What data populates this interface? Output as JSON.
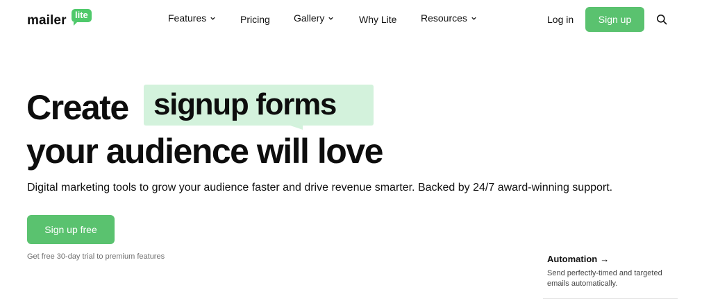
{
  "brand": {
    "name": "mailer",
    "badge": "lite",
    "accent": "#5ac26f",
    "highlight": "#d3f2dc"
  },
  "nav": {
    "items": [
      {
        "label": "Features",
        "dropdown": true
      },
      {
        "label": "Pricing",
        "dropdown": false
      },
      {
        "label": "Gallery",
        "dropdown": true
      },
      {
        "label": "Why Lite",
        "dropdown": false
      },
      {
        "label": "Resources",
        "dropdown": true
      }
    ],
    "login": "Log in",
    "signup": "Sign up",
    "search_icon": "search-icon"
  },
  "hero": {
    "line1_start": "Create",
    "line1_highlight": "signup forms",
    "line2": "your audience will love",
    "subtitle": "Digital marketing tools to grow your audience faster and drive revenue smarter. Backed by 24/7 award-winning support.",
    "cta": "Sign up free",
    "trial_note": "Get free 30-day trial to premium features"
  },
  "feature_card": {
    "title": "Automation",
    "arrow": "→",
    "description": "Send perfectly-timed and targeted emails automatically."
  }
}
